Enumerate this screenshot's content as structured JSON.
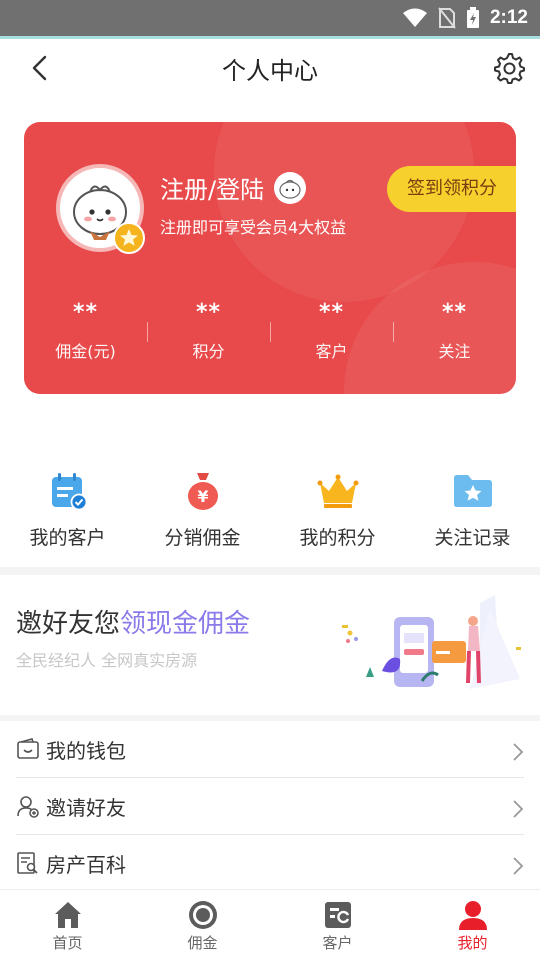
{
  "status_bar": {
    "time": "2:12",
    "icons": [
      "wifi-icon",
      "no-sim-icon",
      "battery-charging-icon"
    ]
  },
  "header": {
    "title": "个人中心",
    "back_icon": "back-arrow-icon",
    "settings_icon": "gear-icon"
  },
  "profile_card": {
    "login_title": "注册/登陆",
    "login_subtitle": "注册即可享受会员4大权益",
    "checkin_label": "签到领积分",
    "bg_color": "#e84a4b",
    "checkin_color": "#f6d02d",
    "stats": [
      {
        "value": "**",
        "label": "佣金(元)"
      },
      {
        "value": "**",
        "label": "积分"
      },
      {
        "value": "**",
        "label": "客户"
      },
      {
        "value": "**",
        "label": "关注"
      }
    ]
  },
  "shortcuts": [
    {
      "label": "我的客户",
      "icon": "customer-calendar-icon"
    },
    {
      "label": "分销佣金",
      "icon": "money-bag-icon"
    },
    {
      "label": "我的积分",
      "icon": "crown-icon"
    },
    {
      "label": "关注记录",
      "icon": "star-folder-icon"
    }
  ],
  "invite_banner": {
    "title_main": "邀好友您",
    "title_highlight": "领现金佣金",
    "subtitle": "全民经纪人 全网真实房源",
    "highlight_color": "#8a7bea"
  },
  "menu": [
    {
      "label": "我的钱包",
      "icon": "wallet-icon"
    },
    {
      "label": "邀请好友",
      "icon": "invite-user-icon"
    },
    {
      "label": "房产百科",
      "icon": "document-search-icon"
    }
  ],
  "tabbar": [
    {
      "label": "首页",
      "icon": "home-icon",
      "active": false
    },
    {
      "label": "佣金",
      "icon": "coin-icon",
      "active": false
    },
    {
      "label": "客户",
      "icon": "customer-card-icon",
      "active": false
    },
    {
      "label": "我的",
      "icon": "user-icon",
      "active": true
    }
  ],
  "accent_color": "#e81f2b"
}
